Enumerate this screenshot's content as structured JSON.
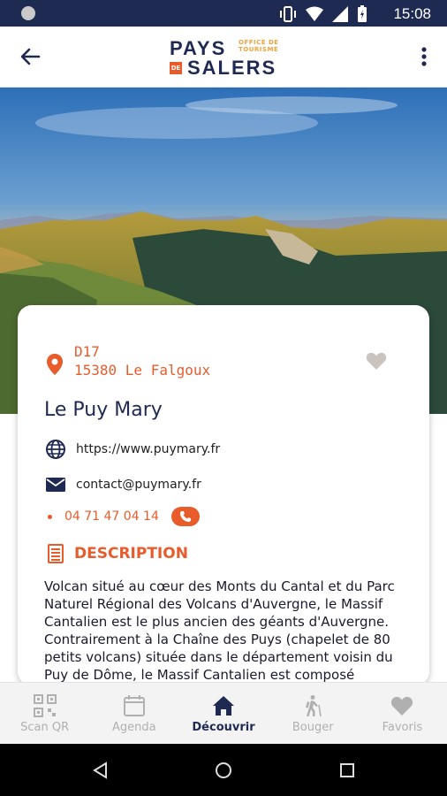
{
  "statusbar": {
    "time": "15:08"
  },
  "appbar": {
    "logo_top": "PAYS",
    "logo_bottom": "SALERS",
    "logo_de": "DE",
    "logo_sub1": "OFFICE DE",
    "logo_sub2": "TOURISME"
  },
  "place": {
    "address_line1": "D17",
    "address_line2": "15380 Le Falgoux",
    "name": "Le Puy Mary",
    "website": "https://www.puymary.fr",
    "email": "contact@puymary.fr",
    "phone": "04 71 47 04 14",
    "description_title": "DESCRIPTION",
    "description": "Volcan situé au cœur des Monts du Cantal et du Parc Naturel Régional des Volcans d'Auvergne, le Massif Cantalien est le plus ancien des géants d'Auvergne. Contrairement à la Chaîne des Puys (chapelet de 80 petits volcans) située dans le département voisin du Puy de Dôme, le Massif Cantalien est composé"
  },
  "nav": {
    "scan": "Scan QR",
    "agenda": "Agenda",
    "decouvrir": "Découvrir",
    "bouger": "Bouger",
    "favoris": "Favoris"
  },
  "colors": {
    "brand": "#1f2a52",
    "accent": "#e85c2c"
  }
}
